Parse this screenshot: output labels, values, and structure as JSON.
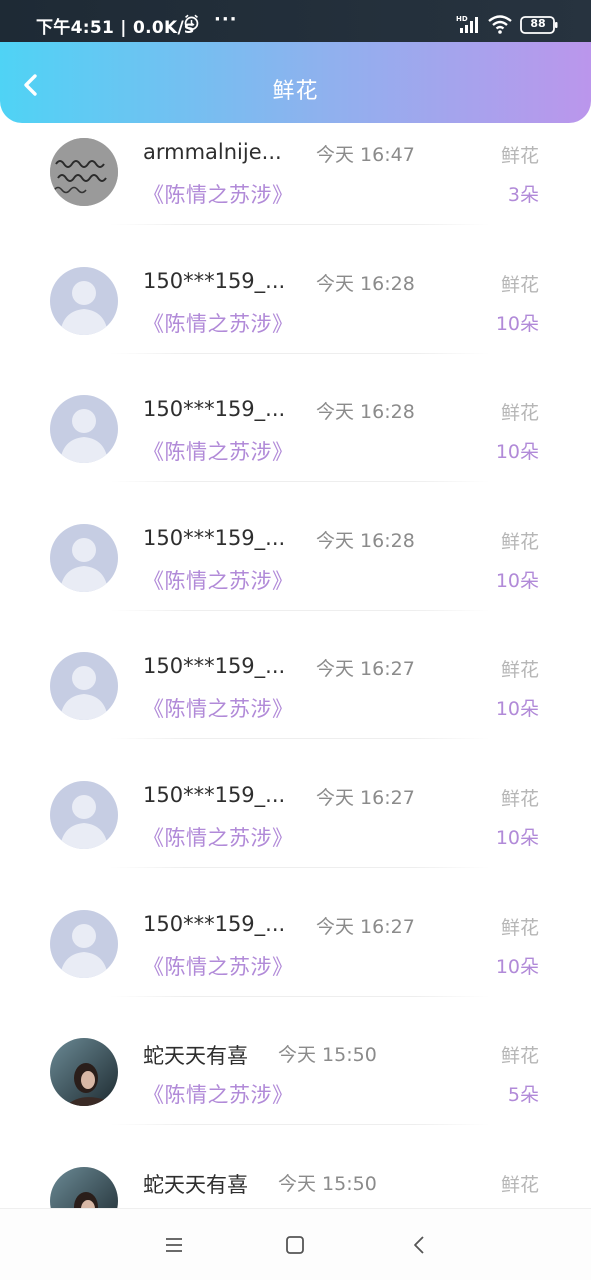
{
  "status_bar": {
    "time_speed": "下午4:51 | 0.0K/s",
    "dots": "···",
    "battery": "88",
    "icons": [
      "alarm-icon",
      "signal-icon",
      "wifi-icon",
      "battery-icon"
    ]
  },
  "header": {
    "title": "鲜花",
    "back_icon": "chevron-left-icon"
  },
  "colors": {
    "gradient_start": "#4fd3f5",
    "gradient_end": "#bb96ec",
    "accent_purple": "#b18ad8"
  },
  "records": [
    {
      "name": "armmalnije...",
      "time": "今天 16:47",
      "kind": "鲜花",
      "book": "《陈情之苏涉》",
      "count": "3朵",
      "avatar": "handwriting-photo"
    },
    {
      "name": "150***159_...",
      "time": "今天 16:28",
      "kind": "鲜花",
      "book": "《陈情之苏涉》",
      "count": "10朵",
      "avatar": "default-user"
    },
    {
      "name": "150***159_...",
      "time": "今天 16:28",
      "kind": "鲜花",
      "book": "《陈情之苏涉》",
      "count": "10朵",
      "avatar": "default-user"
    },
    {
      "name": "150***159_...",
      "time": "今天 16:28",
      "kind": "鲜花",
      "book": "《陈情之苏涉》",
      "count": "10朵",
      "avatar": "default-user"
    },
    {
      "name": "150***159_...",
      "time": "今天 16:27",
      "kind": "鲜花",
      "book": "《陈情之苏涉》",
      "count": "10朵",
      "avatar": "default-user"
    },
    {
      "name": "150***159_...",
      "time": "今天 16:27",
      "kind": "鲜花",
      "book": "《陈情之苏涉》",
      "count": "10朵",
      "avatar": "default-user"
    },
    {
      "name": "150***159_...",
      "time": "今天 16:27",
      "kind": "鲜花",
      "book": "《陈情之苏涉》",
      "count": "10朵",
      "avatar": "default-user"
    },
    {
      "name": "蛇天天有喜",
      "time": "今天 15:50",
      "kind": "鲜花",
      "book": "《陈情之苏涉》",
      "count": "5朵",
      "avatar": "portrait-photo"
    },
    {
      "name": "蛇天天有喜",
      "time": "今天 15:50",
      "kind": "鲜花",
      "book": "",
      "count": "",
      "avatar": "portrait-photo"
    }
  ],
  "nav": {
    "icons": [
      "menu-icon",
      "home-square-icon",
      "back-triangle-icon"
    ]
  }
}
